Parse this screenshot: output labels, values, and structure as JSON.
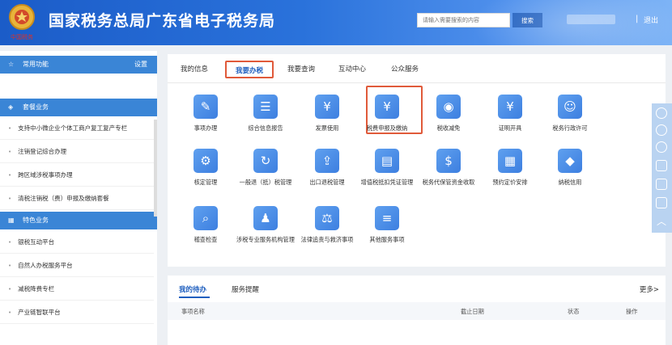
{
  "header": {
    "site_title": "国家税务总局广东省电子税务局",
    "emblem_caption": "中国税务",
    "search_placeholder": "请输入需要搜索的内容",
    "search_button": "搜索",
    "divider": "|",
    "logout": "退出"
  },
  "sidebar": {
    "common": {
      "title": "常用功能",
      "settings": "设置"
    },
    "package": {
      "title": "套餐业务",
      "items": [
        "支持中小微企业个体工商户复工复产专栏",
        "注销登记综合办理",
        "跨区域涉税事项办理",
        "清税注销税（费）申报及缴纳套餐"
      ]
    },
    "special": {
      "title": "特色业务",
      "items": [
        "银税互动平台",
        "自然人办税服务平台",
        "减税降费专栏",
        "产业链智联平台"
      ]
    }
  },
  "tabs": [
    "我的信息",
    "我要办税",
    "我要查询",
    "互动中心",
    "公众服务"
  ],
  "services": [
    {
      "label": "事项办理",
      "icon": "pen-icon",
      "color": "#3d7fe0"
    },
    {
      "label": "综合信息报告",
      "icon": "document-list-icon",
      "color": "#3d7fe0"
    },
    {
      "label": "发票使用",
      "icon": "invoice-icon",
      "color": "#3d7fe0"
    },
    {
      "label": "税费申报及缴纳",
      "icon": "tax-box-icon",
      "color": "#3d7fe0"
    },
    {
      "label": "税收减免",
      "icon": "coin-stack-icon",
      "color": "#3d7fe0"
    },
    {
      "label": "证明开具",
      "icon": "certificate-icon",
      "color": "#3d7fe0"
    },
    {
      "label": "税务行政许可",
      "icon": "id-badge-icon",
      "color": "#3d7fe0"
    },
    {
      "label": "核定管理",
      "icon": "user-gear-icon",
      "color": "#3d7fe0"
    },
    {
      "label": "一般退（抵）税管理",
      "icon": "refund-cycle-icon",
      "color": "#3d7fe0"
    },
    {
      "label": "出口退税管理",
      "icon": "export-icon",
      "color": "#3d7fe0"
    },
    {
      "label": "增值税抵扣凭证管理",
      "icon": "receipt-icon",
      "color": "#3d7fe0"
    },
    {
      "label": "税务代保管资金收取",
      "icon": "money-bag-icon",
      "color": "#3d7fe0"
    },
    {
      "label": "预约定价安排",
      "icon": "calendar-icon",
      "color": "#3d7fe0"
    },
    {
      "label": "纳税信用",
      "icon": "diamond-icon",
      "color": "#3d7fe0"
    },
    {
      "label": "稽查检查",
      "icon": "inspection-icon",
      "color": "#3d7fe0"
    },
    {
      "label": "涉税专业服务机构管理",
      "icon": "agent-user-icon",
      "color": "#3d7fe0"
    },
    {
      "label": "法律追责与救济事项",
      "icon": "gavel-icon",
      "color": "#3d7fe0"
    },
    {
      "label": "其他服务事项",
      "icon": "other-doc-icon",
      "color": "#3d7fe0"
    }
  ],
  "todo": {
    "tab_mine": "我的待办",
    "tab_remind": "服务提醒",
    "more": "更多>",
    "columns": [
      "事项名称",
      "截止日期",
      "状态",
      "操作"
    ]
  },
  "colors": {
    "accent": "#1f5fbf",
    "highlight": "#e05a3a",
    "sidebar_head": "#3a85d6"
  }
}
